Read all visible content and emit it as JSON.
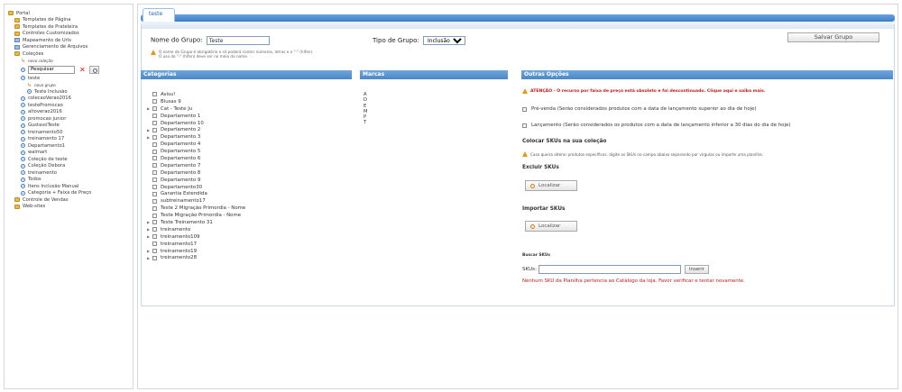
{
  "sidebar": {
    "items": [
      {
        "icon": "folder-icon",
        "label": "Portal",
        "level": 0
      },
      {
        "icon": "folder-icon",
        "label": "Templates de Página",
        "level": 1
      },
      {
        "icon": "folder-icon",
        "label": "Templates de Prateleira",
        "level": 1
      },
      {
        "icon": "folder-icon",
        "label": "Controles Customizados",
        "level": 1
      },
      {
        "icon": "document-icon",
        "label": "Mapeamento de Urls",
        "level": 1
      },
      {
        "icon": "document-icon",
        "label": "Gerenciamento de Arquivos",
        "level": 1
      },
      {
        "icon": "folder-icon",
        "label": "Coleções",
        "level": 1
      },
      {
        "icon": "add-icon",
        "label": "novo coleção",
        "level": 2,
        "small": true
      }
    ],
    "search": {
      "value": "Pesquisar"
    },
    "items2": [
      {
        "icon": "collection-icon",
        "label": "teste",
        "level": 2
      },
      {
        "icon": "add-icon",
        "label": "novo grupo",
        "level": 3,
        "small": true
      },
      {
        "icon": "collection-icon",
        "label": "Teste Inclusão",
        "level": 3
      },
      {
        "icon": "collection-icon",
        "label": "colecaoVerao2016",
        "level": 2
      },
      {
        "icon": "collection-icon",
        "label": "testePromocao",
        "level": 2
      },
      {
        "icon": "collection-icon",
        "label": "altoverao2016",
        "level": 2
      },
      {
        "icon": "collection-icon",
        "label": "promocao junior",
        "level": 2
      },
      {
        "icon": "collection-icon",
        "label": "GustavoTeste",
        "level": 2
      },
      {
        "icon": "collection-icon",
        "label": "treinamento50",
        "level": 2
      },
      {
        "icon": "collection-icon",
        "label": "treinamento 17",
        "level": 2
      },
      {
        "icon": "collection-icon",
        "label": "Departamento1",
        "level": 2
      },
      {
        "icon": "collection-icon",
        "label": "walmart",
        "level": 2
      },
      {
        "icon": "collection-icon",
        "label": "Coleção de teste",
        "level": 2
      },
      {
        "icon": "collection-icon",
        "label": "Coleção Debora",
        "level": 2
      },
      {
        "icon": "collection-icon",
        "label": "treinamento",
        "level": 2
      },
      {
        "icon": "collection-icon",
        "label": "Todos",
        "level": 2
      },
      {
        "icon": "collection-icon",
        "label": "Itens Inclusão Manual",
        "level": 2
      },
      {
        "icon": "collection-icon",
        "label": "Categoria + Faixa de Preço",
        "level": 2
      },
      {
        "icon": "folder-icon",
        "label": "Controle de Vendas",
        "level": 1
      },
      {
        "icon": "folder-icon",
        "label": "Web-sites",
        "level": 1
      }
    ]
  },
  "tab": {
    "label": "teste"
  },
  "form": {
    "group_name_label": "Nome do Grupo:",
    "group_name_value": "Teste",
    "hint_line1": "O nome do Grupo é obrigatório e só poderá conter números, letras e o \"-\" (hífen).",
    "hint_line2": "O uso do \"-\" (hífen) deve ser no meio do nome.",
    "group_type_label": "Tipo de Grupo:",
    "group_type_value": "Inclusão",
    "save_label": "Salvar Grupo"
  },
  "columns": {
    "categorias": "Categorias",
    "marcas": "Marcas",
    "outras": "Outras Opções"
  },
  "categories": [
    {
      "label": "Avisu!",
      "expand": false
    },
    {
      "label": "Blusas 9",
      "expand": false
    },
    {
      "label": "Cat - Teste Ju",
      "expand": true
    },
    {
      "label": "Departamento 1",
      "expand": false
    },
    {
      "label": "Departamento 10",
      "expand": false
    },
    {
      "label": "Departamento 2",
      "expand": true
    },
    {
      "label": "Departamento 3",
      "expand": true
    },
    {
      "label": "Departamento 4",
      "expand": false
    },
    {
      "label": "Departamento 5",
      "expand": false
    },
    {
      "label": "Departamento 6",
      "expand": false
    },
    {
      "label": "Departamento 7",
      "expand": false
    },
    {
      "label": "Departamento 8",
      "expand": false
    },
    {
      "label": "Departamento 9",
      "expand": false
    },
    {
      "label": "Departamento30",
      "expand": false
    },
    {
      "label": "Garantia Estendida",
      "expand": false
    },
    {
      "label": "subtreinamento17",
      "expand": false
    },
    {
      "label": "Teste 2 Migração Primordia - Nome",
      "expand": false
    },
    {
      "label": "Teste Migração Primordia - Nome",
      "expand": false
    },
    {
      "label": "Teste Treinamento 31",
      "expand": true
    },
    {
      "label": "treinamento",
      "expand": true
    },
    {
      "label": "treinamento109",
      "expand": true
    },
    {
      "label": "treinamento17",
      "expand": false
    },
    {
      "label": "treinamento19",
      "expand": true
    },
    {
      "label": "treinamento28",
      "expand": true
    }
  ],
  "brands": [
    "A",
    "D",
    "E",
    "M",
    "P",
    "T"
  ],
  "options": {
    "warning": "ATENÇÃO - O recurso por faixa de preço está obsoleto e foi descontinuado. Clique aqui e saiba mais.",
    "prevenda": "Pré-venda (Serão considerados produtos com a data de lançamento superior ao dia de hoje)",
    "lancamento": "Lançamento (Serão considerados os produtos com a data de lançamento inferior a 30 dias do dia de hoje)",
    "colocar_title": "Colocar SKUs na sua coleção",
    "colocar_hint": "Caso queira alterar produtos específicos, digite os SKUs no campo abaixo separando por vírgulas ou importe uma planilha.",
    "excluir_title": "Excluir SKUs",
    "localizar": "Localizar",
    "importar_title": "Importar SKUs",
    "buscar_title": "Buscar SKUs",
    "skus_label": "SKUs:",
    "skus_value": "",
    "inserir": "Inserir",
    "error": "Nenhum SKU da Planilha pertencia ao Catálogo da loja. Favor verificar e tentar novamente."
  }
}
